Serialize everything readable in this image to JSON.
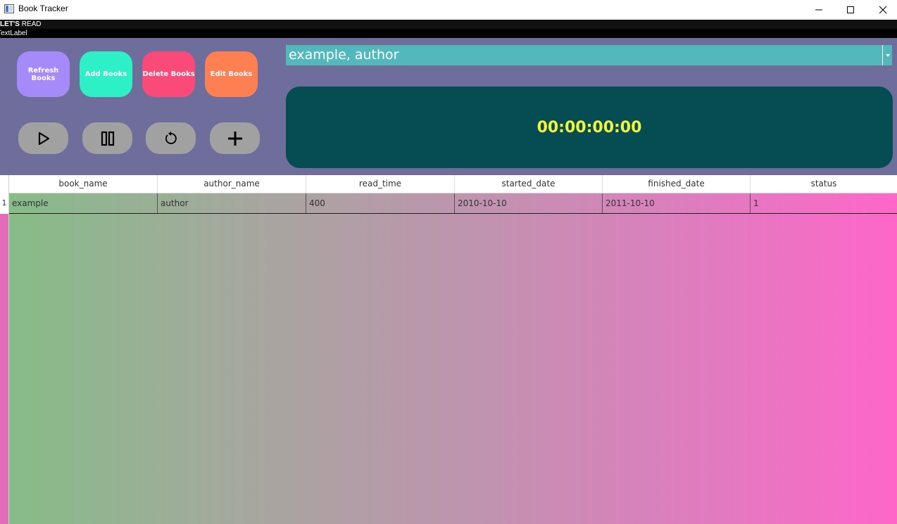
{
  "window": {
    "title": "Book Tracker"
  },
  "header": {
    "lets_bold": "LET'S",
    "lets_rest": " READ",
    "text_label": "TextLabel"
  },
  "toolbar": {
    "refresh_label": "Refresh Books",
    "add_label": "Add Books",
    "delete_label": "Delete Books",
    "edit_label": "Edit Books"
  },
  "controls": {
    "play_icon": "play-icon",
    "pause_icon": "pause-icon",
    "reset_icon": "reset-icon",
    "plus_icon": "plus-icon"
  },
  "book_select": {
    "selected": "example, author"
  },
  "timer": {
    "value": "00:00:00:00"
  },
  "colors": {
    "refresh": "#a48bf9",
    "add": "#2ef0c6",
    "delete": "#fa4a7a",
    "edit": "#fd7f52",
    "panel": "#6e6d9b",
    "combo": "#52b8bb",
    "timer_bg": "#054d53",
    "timer_text": "#f6f33c"
  },
  "table": {
    "columns": [
      "book_name",
      "author_name",
      "read_time",
      "started_date",
      "finished_date",
      "status"
    ],
    "rows": [
      {
        "num": "1",
        "cells": [
          "example",
          "author",
          "400",
          "2010-10-10",
          "2011-10-10",
          "1"
        ]
      }
    ]
  }
}
